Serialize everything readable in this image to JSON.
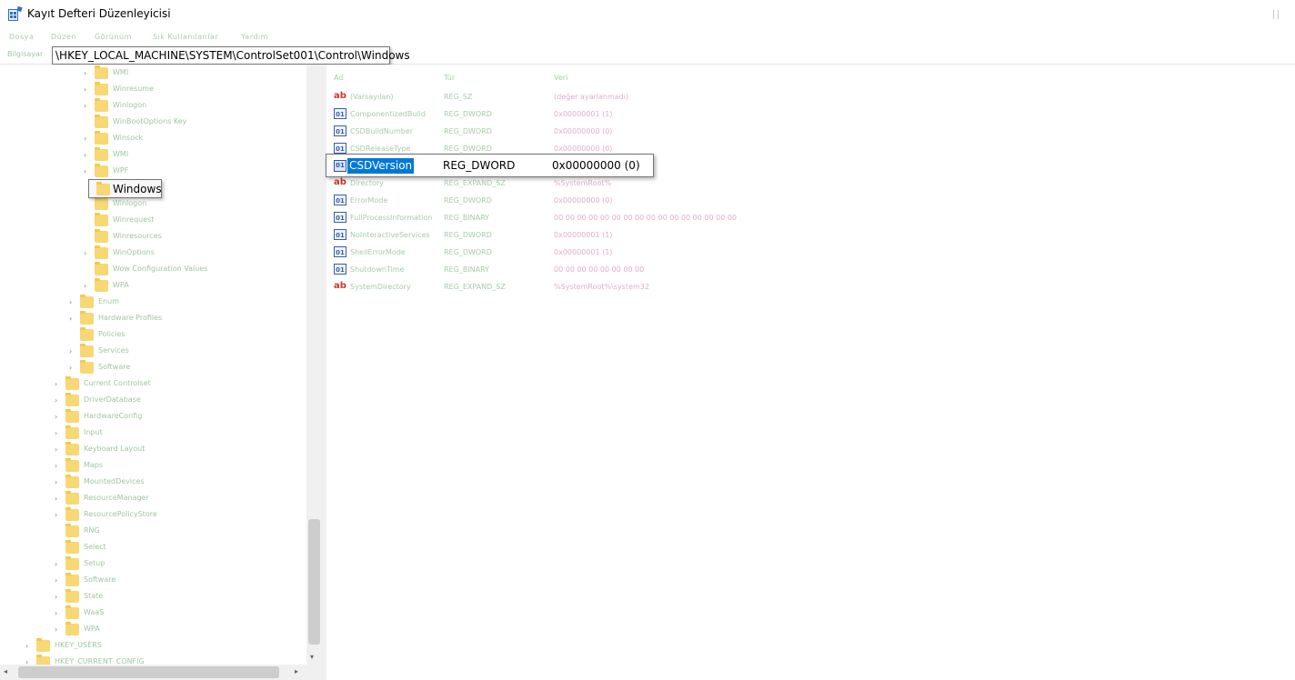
{
  "window": {
    "title": "Kayıt Defteri Düzenleyicisi"
  },
  "menubar": {
    "items": [
      "Dosya",
      "Düzen",
      "Görünüm",
      "Sık Kullanılanlar",
      "Yardım"
    ]
  },
  "address": {
    "prefix": "Bilgisayar",
    "path": "\\HKEY_LOCAL_MACHINE\\SYSTEM\\ControlSet001\\Control\\Windows"
  },
  "tree": {
    "items": [
      {
        "label": "WMI"
      },
      {
        "label": "Winresume"
      },
      {
        "label": "Winlogon"
      },
      {
        "label": "WinBootOptions Key"
      },
      {
        "label": "Winsock"
      },
      {
        "label": "WMI"
      },
      {
        "label": "WPF"
      },
      {
        "label": "Windows"
      },
      {
        "label": "Winlogon"
      },
      {
        "label": "Winrequest"
      },
      {
        "label": "Winresources"
      },
      {
        "label": "WinOptions"
      },
      {
        "label": "Wow Configuration Values"
      },
      {
        "label": "WPA"
      },
      {
        "label": "Enum"
      },
      {
        "label": "Hardware Profiles"
      },
      {
        "label": "Policies"
      },
      {
        "label": "Services"
      },
      {
        "label": "Software"
      },
      {
        "label": "Current Controlset"
      },
      {
        "label": "DriverDatabase"
      },
      {
        "label": "HardwareConfig"
      },
      {
        "label": "Input"
      },
      {
        "label": "Keyboard Layout"
      },
      {
        "label": "Maps"
      },
      {
        "label": "MountedDevices"
      },
      {
        "label": "ResourceManager"
      },
      {
        "label": "ResourcePolicyStore"
      },
      {
        "label": "RNG"
      },
      {
        "label": "Select"
      },
      {
        "label": "Setup"
      },
      {
        "label": "Software"
      },
      {
        "label": "State"
      },
      {
        "label": "WaaS"
      },
      {
        "label": "WPA"
      },
      {
        "label": "HKEY_USERS"
      },
      {
        "label": "HKEY_CURRENT_CONFIG"
      }
    ],
    "tooltip_label": "Windows"
  },
  "values": {
    "columns": {
      "name": "Ad",
      "type": "Tür",
      "data": "Veri"
    },
    "rows": [
      {
        "icon": "string",
        "name": "(Varsayılan)",
        "type": "REG_SZ",
        "data": "(değer ayarlanmadı)"
      },
      {
        "icon": "binary",
        "name": "ComponentizedBuild",
        "type": "REG_DWORD",
        "data": "0x00000001 (1)"
      },
      {
        "icon": "binary",
        "name": "CSDBuildNumber",
        "type": "REG_DWORD",
        "data": "0x00000000 (0)"
      },
      {
        "icon": "binary",
        "name": "CSDReleaseType",
        "type": "REG_DWORD",
        "data": "0x00000000 (0)"
      },
      {
        "icon": "binary",
        "name": "CSDVersion",
        "type": "REG_DWORD",
        "data": "0x00000000 (0)"
      },
      {
        "icon": "string",
        "name": "Directory",
        "type": "REG_EXPAND_SZ",
        "data": "%SystemRoot%"
      },
      {
        "icon": "binary",
        "name": "ErrorMode",
        "type": "REG_DWORD",
        "data": "0x00000000 (0)"
      },
      {
        "icon": "binary",
        "name": "FullProcessInformation",
        "type": "REG_BINARY",
        "data": "00 00 00 00 00 00 00 00 00 00 00 00 00 00 00 00"
      },
      {
        "icon": "binary",
        "name": "NoInteractiveServices",
        "type": "REG_DWORD",
        "data": "0x00000001 (1)"
      },
      {
        "icon": "binary",
        "name": "ShellErrorMode",
        "type": "REG_DWORD",
        "data": "0x00000001 (1)"
      },
      {
        "icon": "binary",
        "name": "ShutdownTime",
        "type": "REG_BINARY",
        "data": "00 00 00 00 00 00 00 00"
      },
      {
        "icon": "string",
        "name": "SystemDirectory",
        "type": "REG_EXPAND_SZ",
        "data": "%SystemRoot%\\system32"
      }
    ],
    "tooltip": {
      "name": "CSDVersion",
      "type": "REG_DWORD",
      "data": "0x00000000 (0)"
    }
  }
}
